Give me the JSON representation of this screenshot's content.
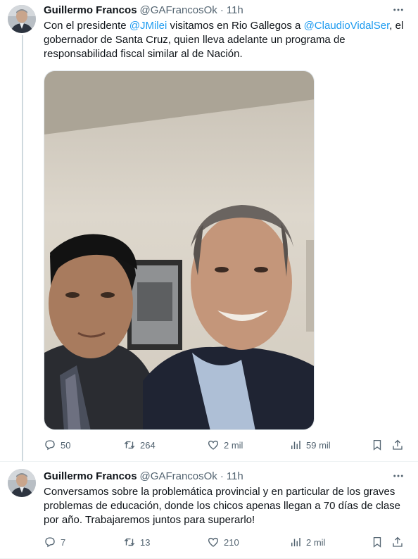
{
  "tweets": [
    {
      "author_name": "Guillermo Francos",
      "handle": "@GAFrancosOk",
      "separator": "·",
      "time": "11h",
      "text_parts": {
        "t1": "Con el presidente ",
        "m1": "@JMilei",
        "t2": " visitamos en Rio Gallegos a ",
        "m2": "@ClaudioVidalSer",
        "t3": ", el gobernador de Santa Cruz, quien lleva adelante un programa de responsabilidad fiscal similar al de Nación."
      },
      "stats": {
        "replies": "50",
        "retweets": "264",
        "likes": "2 mil",
        "views": "59 mil"
      }
    },
    {
      "author_name": "Guillermo Francos",
      "handle": "@GAFrancosOk",
      "separator": "·",
      "time": "11h",
      "text": "Conversamos sobre la problemática provincial y en particular de los graves problemas de educación, donde los chicos apenas llegan a 70 días de clase por año. Trabajaremos juntos para superarlo!",
      "stats": {
        "replies": "7",
        "retweets": "13",
        "likes": "210",
        "views": "2 mil"
      }
    }
  ],
  "icons": [
    "more-icon",
    "reply-icon",
    "retweet-icon",
    "like-icon",
    "views-icon",
    "bookmark-icon",
    "share-icon"
  ],
  "colors": {
    "link": "#1d9bf0",
    "secondary_text": "#536471",
    "primary_text": "#0f1419",
    "thread_line": "#cfd9de"
  }
}
